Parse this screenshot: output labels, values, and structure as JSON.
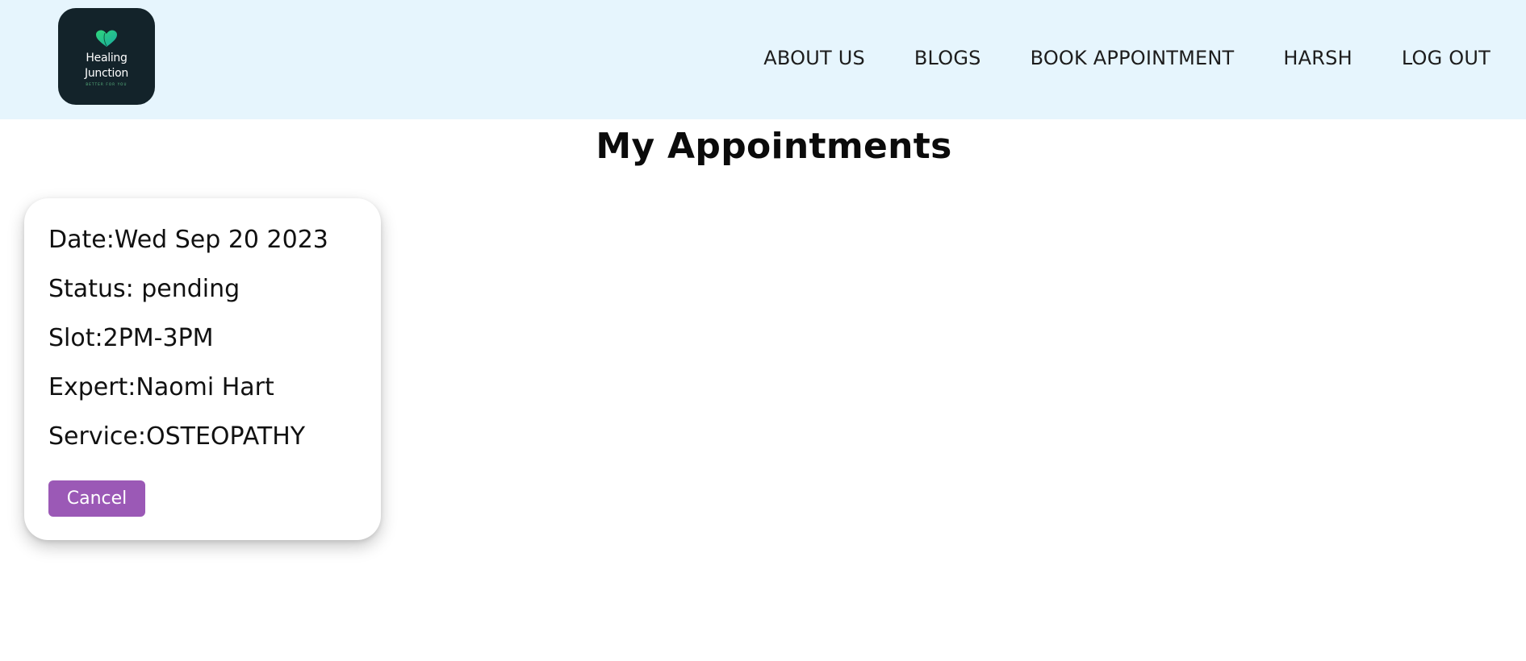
{
  "brand": {
    "line1": "Healing",
    "line2": "Junction",
    "tagline": "BETTER FOR YOU",
    "icon": "heart-leaf-icon"
  },
  "nav": {
    "items": [
      {
        "label": "ABOUT US"
      },
      {
        "label": "BLOGS"
      },
      {
        "label": "BOOK APPOINTMENT"
      },
      {
        "label": "HARSH"
      },
      {
        "label": "LOG OUT"
      }
    ]
  },
  "main": {
    "title": "My Appointments"
  },
  "appointments": [
    {
      "date": "Date:Wed Sep 20 2023",
      "status": "Status: pending",
      "slot": "Slot:2PM-3PM",
      "expert": "Expert:Naomi Hart",
      "service": "Service:OSTEOPATHY",
      "cancel_label": "Cancel"
    }
  ],
  "colors": {
    "navbar_bg": "#e6f5fd",
    "logo_bg": "#13232a",
    "cancel_button": "#9b59b6",
    "logo_accent": "#5fbf86"
  }
}
